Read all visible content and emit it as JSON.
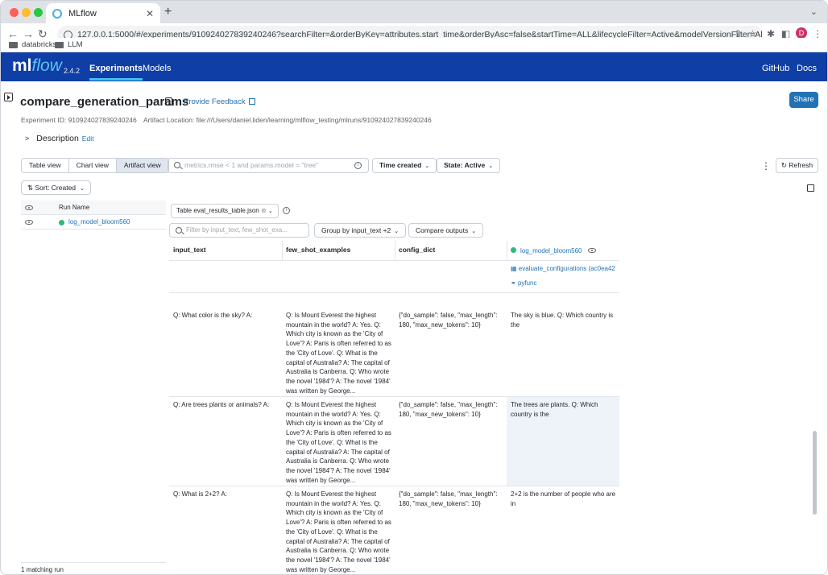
{
  "browser": {
    "tab_title": "MLflow",
    "url": "127.0.0.1:5000/#/experiments/910924027839240246?searchFilter=&orderByKey=attributes.start_time&orderByAsc=false&startTime=ALL&lifecycleFilter=Active&modelVersionFilter=All%20Runs&selectedColumn...",
    "profile_initial": "D",
    "bookmarks": [
      "databricks",
      "LLM"
    ]
  },
  "header": {
    "logo_ml": "ml",
    "logo_flow": "flow",
    "version": "2.4.2",
    "nav": [
      "Experiments",
      "Models"
    ],
    "right_links": [
      "GitHub",
      "Docs"
    ]
  },
  "experiment": {
    "title": "compare_generation_params",
    "feedback": "Provide Feedback",
    "share": "Share",
    "id_text": "Experiment ID: 910924027839240246",
    "artifact_text": "Artifact Location: file:///Users/daniel.liden/learning/mlflow_testing/mlruns/910924027839240246",
    "description": "Description",
    "edit": "Edit"
  },
  "controls": {
    "views": [
      "Table view",
      "Chart view",
      "Artifact view"
    ],
    "search_placeholder": "metrics.rmse < 1 and params.model = \"tree\"",
    "time_created": "Time created",
    "state": "State: Active",
    "refresh": "Refresh",
    "sort": "Sort: Created"
  },
  "runs": {
    "column": "Run Name",
    "items": [
      "log_model_bloom560"
    ],
    "matching": "1 matching run"
  },
  "artifact": {
    "table_label": "Table",
    "table_file": "eval_results_table.json",
    "filter_placeholder": "Filter by input_text, few_shot_exa...",
    "group_by": "Group by input_text",
    "group_extra": "+2",
    "compare": "Compare outputs",
    "columns": [
      "input_text",
      "few_shot_examples",
      "config_dict"
    ],
    "run_name": "log_model_bloom560",
    "run_table": "evaluate_configurations (ac0ea42",
    "run_flavor": "pyfunc",
    "rows": [
      {
        "input_text": "Q: What color is the sky? A:",
        "few_shot": "Q: Is Mount Everest the highest mountain in the world? A: Yes. Q: Which city is known as the 'City of Love'? A: Paris is often referred to as the 'City of Love'. Q: What is the capital of Australia? A: The capital of Australia is Canberra. Q: Who wrote the novel '1984'? A: The novel '1984' was written by George...",
        "config": "{\"do_sample\": false, \"max_length\": 180, \"max_new_tokens\": 10}",
        "output": "The sky is blue. Q: Which country is the"
      },
      {
        "input_text": "Q: Are trees plants or animals? A:",
        "few_shot": "Q: Is Mount Everest the highest mountain in the world? A: Yes. Q: Which city is known as the 'City of Love'? A: Paris is often referred to as the 'City of Love'. Q: What is the capital of Australia? A: The capital of Australia is Canberra. Q: Who wrote the novel '1984'? A: The novel '1984' was written by George...",
        "config": "{\"do_sample\": false, \"max_length\": 180, \"max_new_tokens\": 10}",
        "output": "The trees are plants. Q: Which country is the"
      },
      {
        "input_text": "Q: What is 2+2? A:",
        "few_shot": "Q: Is Mount Everest the highest mountain in the world? A: Yes. Q: Which city is known as the 'City of Love'? A: Paris is often referred to as the 'City of Love'. Q: What is the capital of Australia? A: The capital of Australia is Canberra. Q: Who wrote the novel '1984'? A: The novel '1984' was written by George...",
        "config": "{\"do_sample\": false, \"max_length\": 180, \"max_new_tokens\": 10}",
        "output": "2+2 is the number of people who are in"
      }
    ]
  },
  "colors": {
    "header_bg": "#0e3ea6",
    "accent": "#2272b4",
    "run_dot": "#2eb87a"
  }
}
